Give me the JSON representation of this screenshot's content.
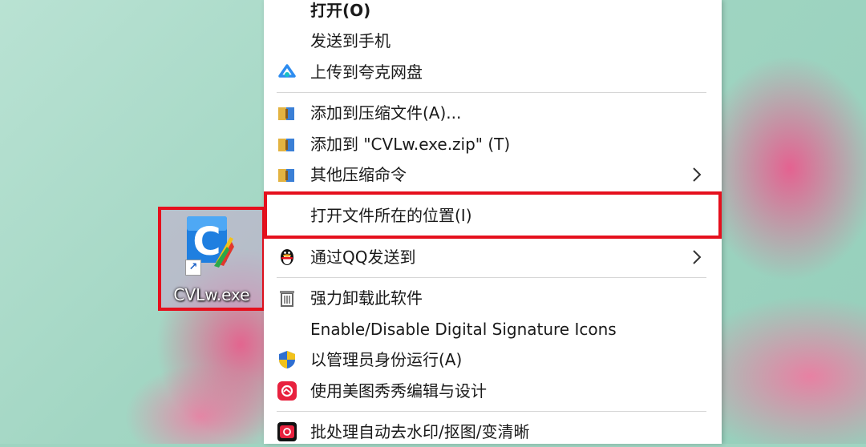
{
  "desktop_icon": {
    "label": "CVLw.exe",
    "glyph": "C"
  },
  "menu": {
    "items": [
      {
        "label": "打开(O)",
        "icon": ""
      },
      {
        "label": "发送到手机",
        "icon": ""
      },
      {
        "label": "上传到夸克网盘",
        "icon": "quark-cloud-icon"
      },
      {
        "label": "添加到压缩文件(A)...",
        "icon": "archive-icon"
      },
      {
        "label": "添加到 \"CVLw.exe.zip\" (T)",
        "icon": "archive-icon"
      },
      {
        "label": "其他压缩命令",
        "icon": "archive-icon",
        "submenu": true
      },
      {
        "label": "打开文件所在的位置(I)",
        "icon": ""
      },
      {
        "label": "通过QQ发送到",
        "icon": "qq-penguin-icon",
        "submenu": true
      },
      {
        "label": "强力卸载此软件",
        "icon": "trash-icon"
      },
      {
        "label": "Enable/Disable Digital Signature Icons",
        "icon": ""
      },
      {
        "label": "以管理员身份运行(A)",
        "icon": "uac-shield-icon"
      },
      {
        "label": "使用美图秀秀编辑与设计",
        "icon": "meitu-icon"
      },
      {
        "label": "批处理自动去水印/抠图/变清晰",
        "icon": "meitu-batch-icon"
      }
    ]
  },
  "colors": {
    "highlight_border": "#e5101d",
    "menu_bg": "#ffffff"
  }
}
